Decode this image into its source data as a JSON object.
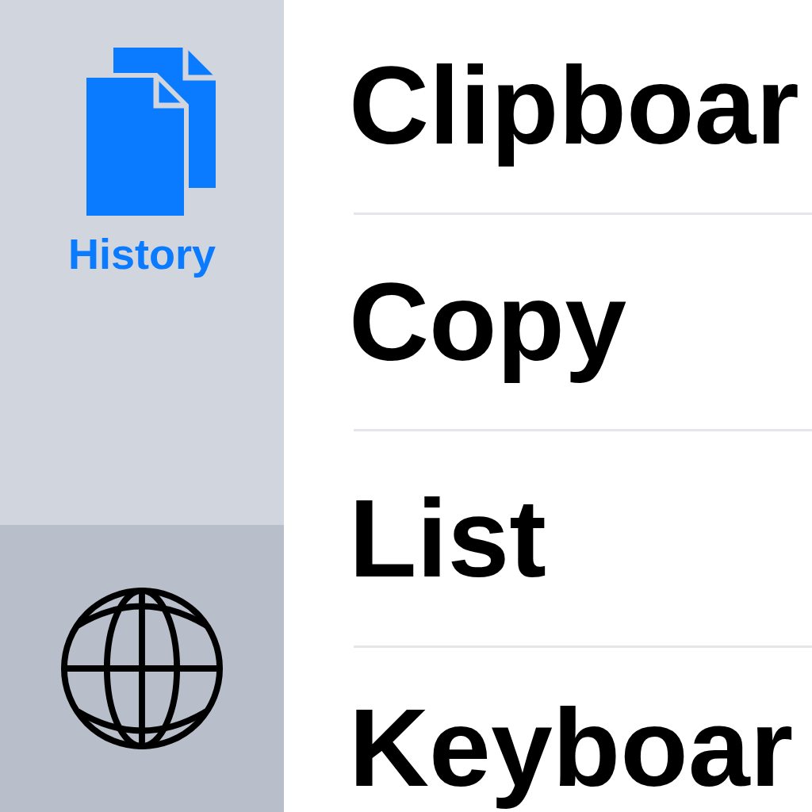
{
  "sidebar": {
    "items": [
      {
        "kind": "documents",
        "label": "History",
        "selected": true
      },
      {
        "kind": "globe",
        "selected": false
      }
    ]
  },
  "list": {
    "rows": [
      {
        "title": "Clipboar"
      },
      {
        "title": "Copy"
      },
      {
        "title": "List"
      },
      {
        "title": "Keyboar"
      }
    ]
  }
}
